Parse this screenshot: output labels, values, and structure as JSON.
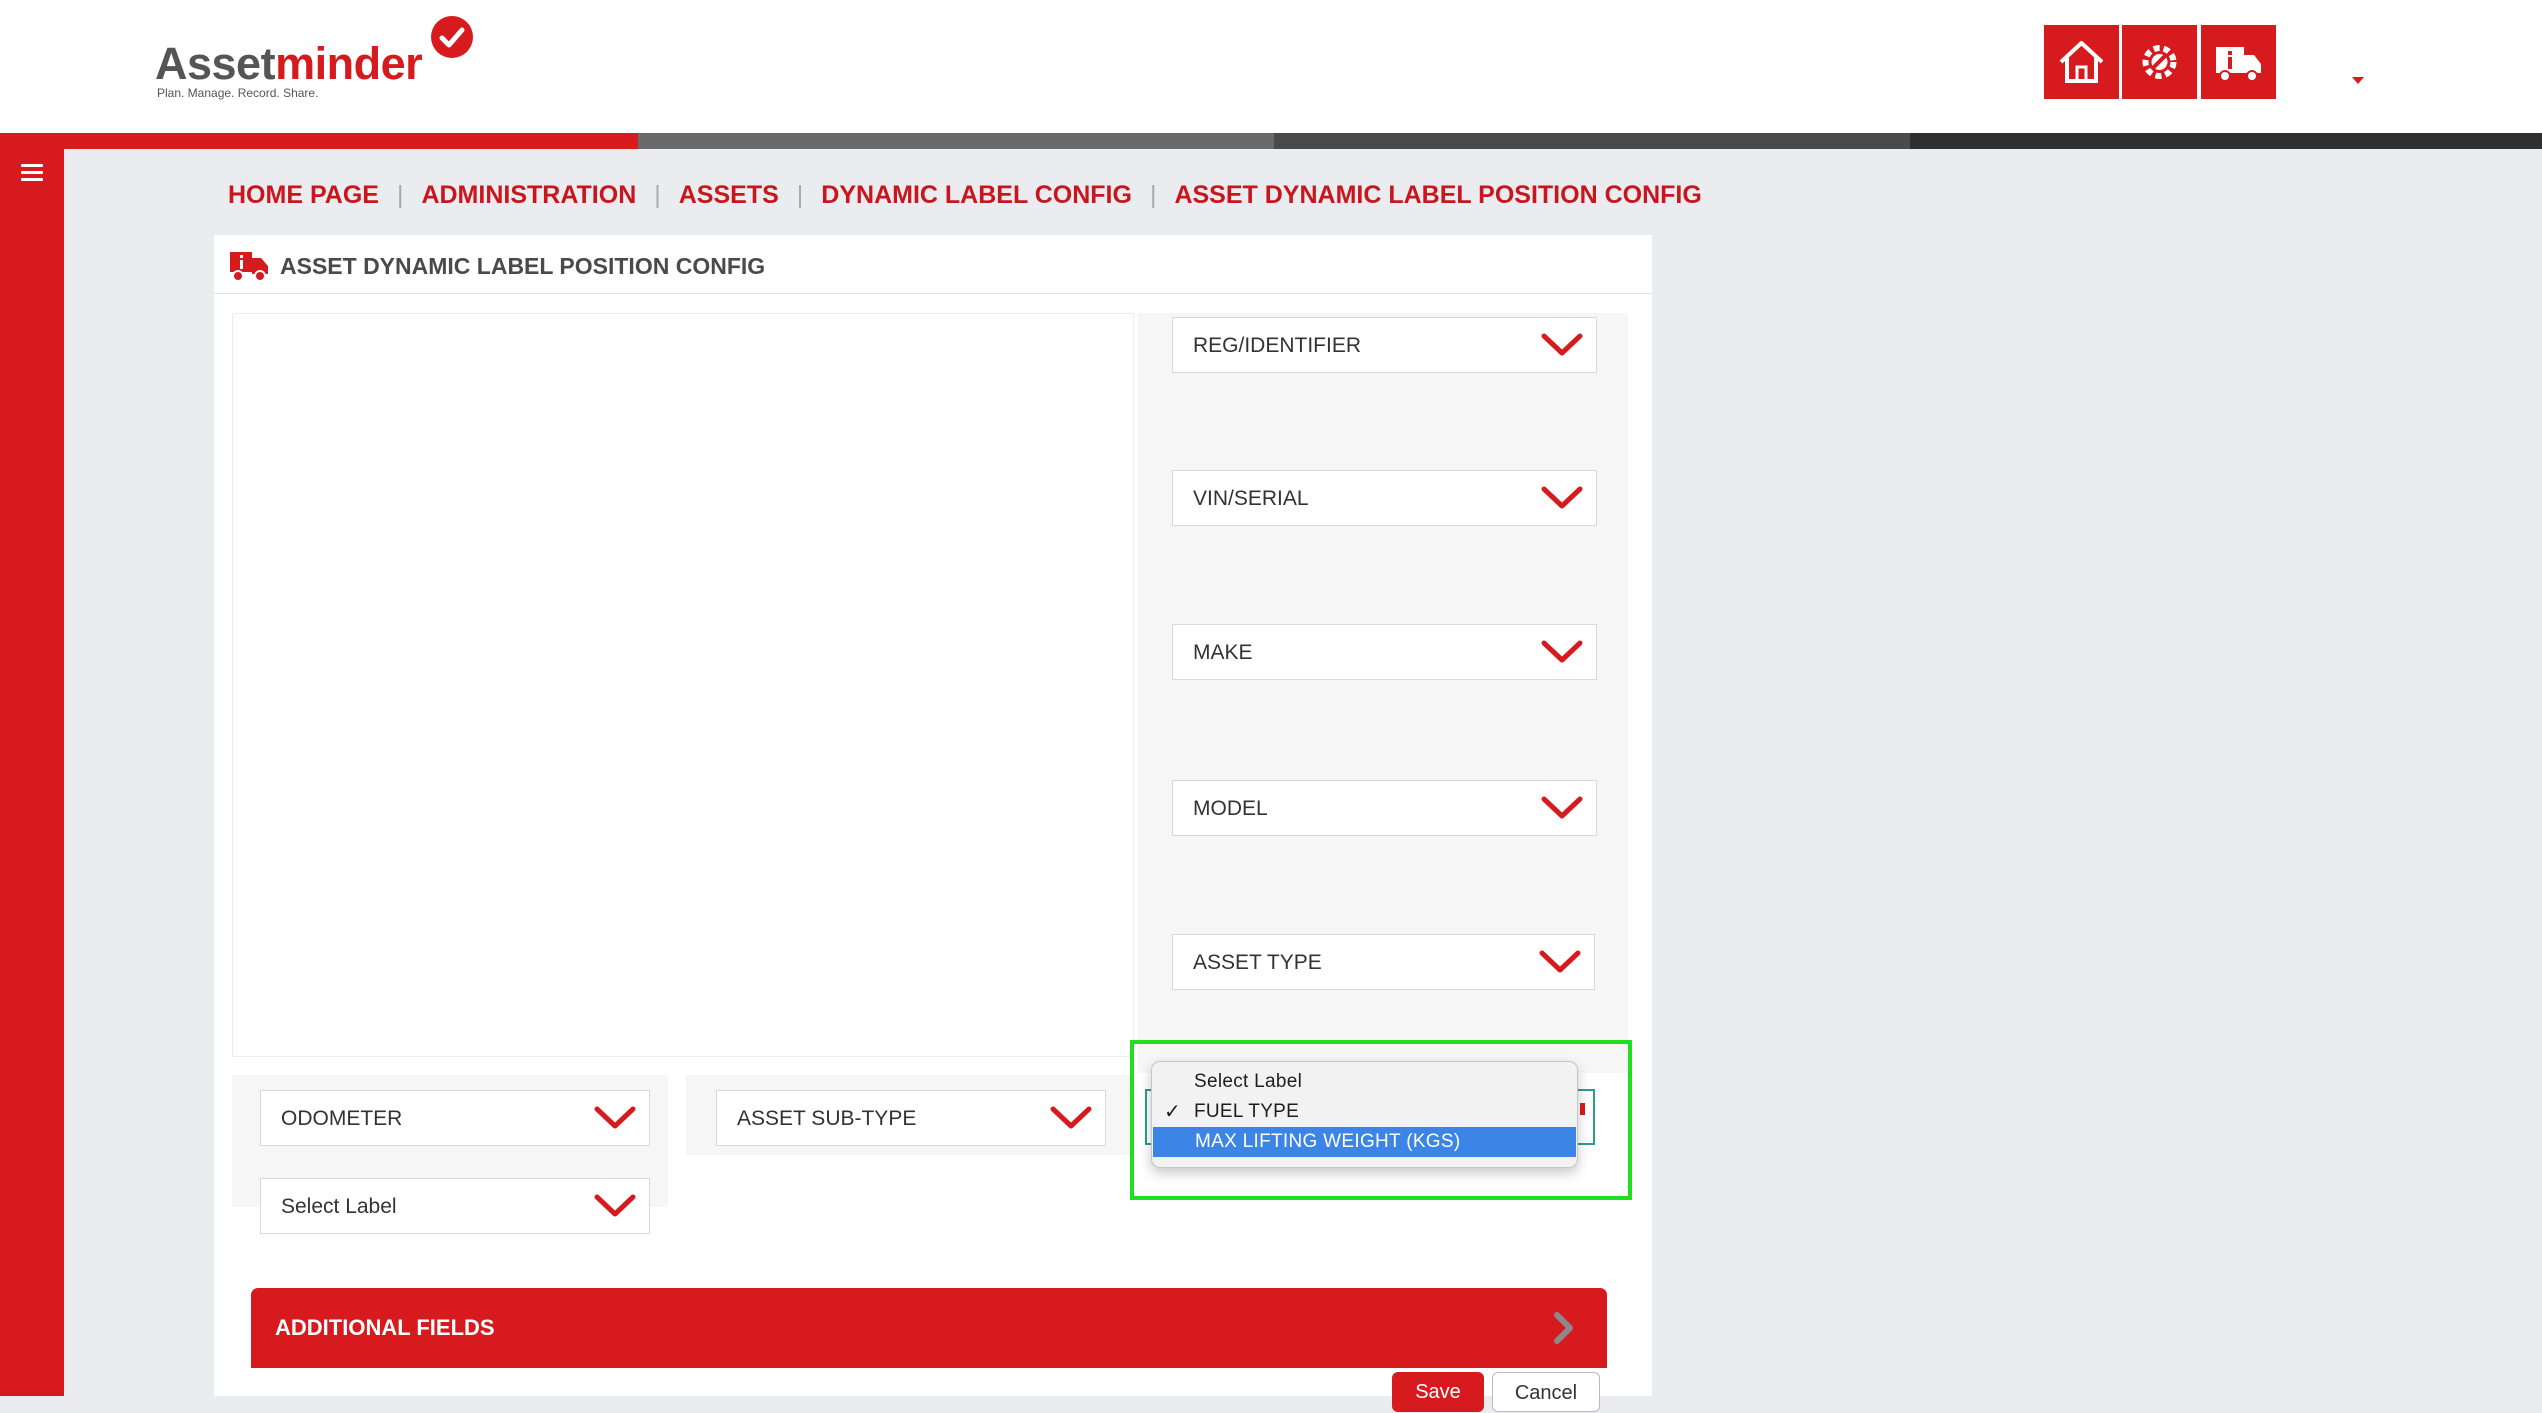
{
  "brand": {
    "name_part1": "Asset",
    "name_part2": "minder",
    "tagline": "Plan. Manage. Record. Share."
  },
  "header": {
    "icons": [
      {
        "name": "home-icon"
      },
      {
        "name": "settings-wrench-icon"
      },
      {
        "name": "truck-info-icon"
      }
    ]
  },
  "breadcrumb": [
    "HOME PAGE",
    "ADMINISTRATION",
    "ASSETS",
    "DYNAMIC LABEL CONFIG",
    "ASSET DYNAMIC LABEL POSITION CONFIG"
  ],
  "panel": {
    "title": "ASSET DYNAMIC LABEL POSITION CONFIG"
  },
  "right_selects": [
    "REG/IDENTIFIER",
    "VIN/SERIAL",
    "MAKE",
    "MODEL",
    "ASSET TYPE"
  ],
  "bottom_selects": [
    "ODOMETER",
    "ASSET SUB-TYPE",
    "Select Label"
  ],
  "dropdown": {
    "options": [
      "Select Label",
      "FUEL TYPE",
      "MAX LIFTING WEIGHT (KGS)"
    ],
    "checked": "FUEL TYPE",
    "highlighted": "MAX LIFTING WEIGHT (KGS)",
    "check_mark": "✓"
  },
  "additional_fields": {
    "label": "ADDITIONAL FIELDS"
  },
  "buttons": {
    "save": "Save",
    "cancel": "Cancel"
  },
  "colors": {
    "brand_red": "#d61a1d",
    "breadcrumb_red": "#c8161d",
    "highlight_green": "#1fdf1f",
    "selection_blue": "#3c84e6"
  }
}
